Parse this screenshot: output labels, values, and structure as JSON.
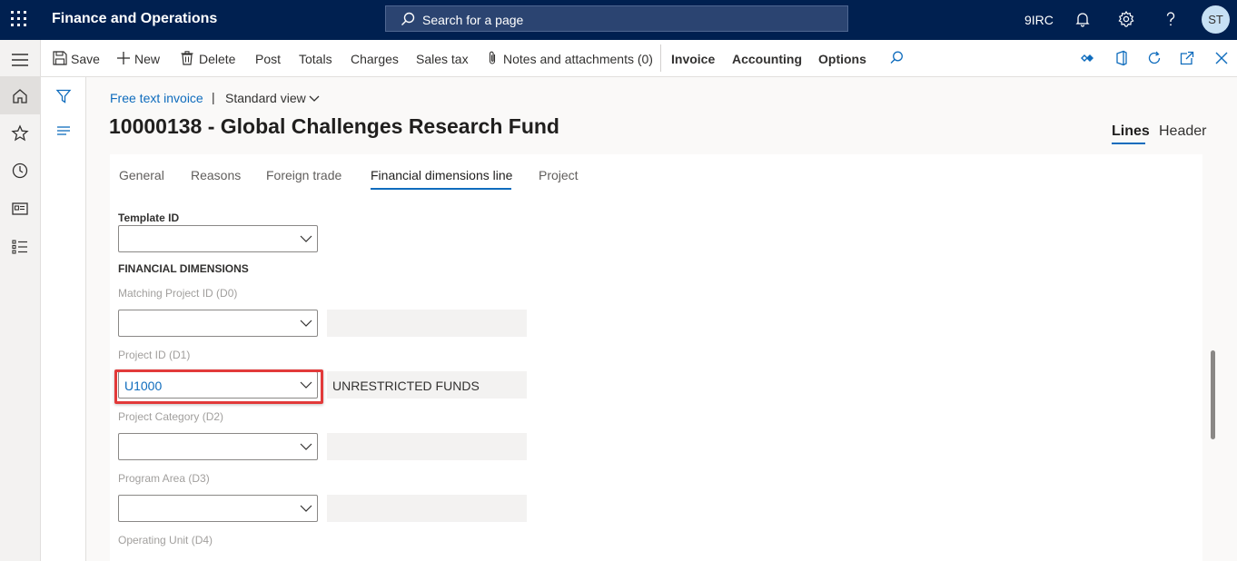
{
  "topbar": {
    "app_title": "Finance and Operations",
    "search_placeholder": "Search for a page",
    "company": "9IRC",
    "avatar_initials": "ST"
  },
  "actionpane": {
    "save": "Save",
    "new": "New",
    "delete": "Delete",
    "post": "Post",
    "totals": "Totals",
    "charges": "Charges",
    "sales_tax": "Sales tax",
    "notes": "Notes and attachments (0)",
    "invoice": "Invoice",
    "accounting": "Accounting",
    "options": "Options"
  },
  "header": {
    "breadcrumb_link": "Free text invoice",
    "breadcrumb_separator": "|",
    "view_name": "Standard view",
    "title": "10000138 - Global Challenges Research Fund",
    "view_tabs": [
      "Lines",
      "Header"
    ],
    "active_view": "Lines"
  },
  "tabs": [
    "General",
    "Reasons",
    "Foreign trade",
    "Financial dimensions line",
    "Project"
  ],
  "active_tab": "Financial dimensions line",
  "form": {
    "template_label": "Template ID",
    "template_value": "",
    "section_title": "FINANCIAL DIMENSIONS",
    "dimensions": [
      {
        "label": "Matching Project ID (D0)",
        "value": "",
        "description": ""
      },
      {
        "label": "Project ID (D1)",
        "value": "U1000",
        "description": "UNRESTRICTED FUNDS"
      },
      {
        "label": "Project Category (D2)",
        "value": "",
        "description": ""
      },
      {
        "label": "Program Area (D3)",
        "value": "",
        "description": ""
      },
      {
        "label": "Operating Unit (D4)",
        "value": "",
        "description": ""
      }
    ]
  },
  "colors": {
    "topbar": "#002050",
    "accent": "#0f6cbd",
    "highlight": "#e23a3a"
  }
}
